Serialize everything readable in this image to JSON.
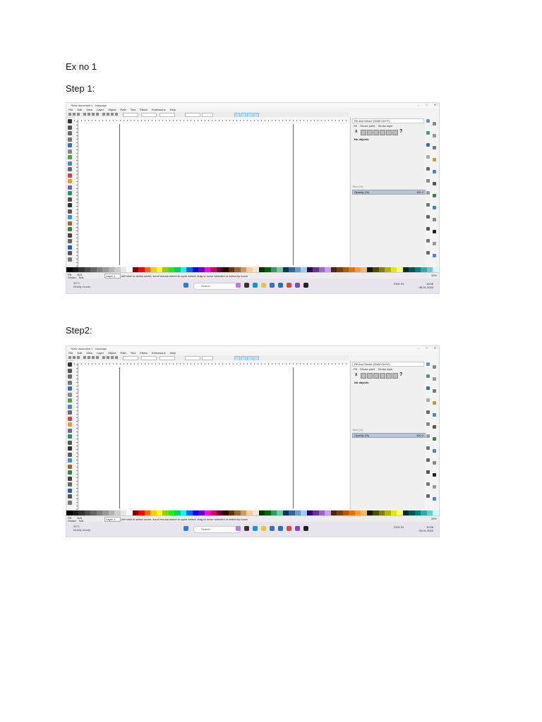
{
  "heading": "Ex no 1",
  "steps": [
    {
      "label": "Step 1:",
      "window_title": "*New document 1 - Inkscape",
      "menu": [
        "File",
        "Edit",
        "View",
        "Layer",
        "Object",
        "Path",
        "Text",
        "Filters",
        "Extensions",
        "Help"
      ],
      "panel_title": "Fill and Stroke (Shift+Ctrl+F)",
      "panel_tabs": [
        "Fill",
        "Stroke paint",
        "Stroke style"
      ],
      "no_objects": "No objects",
      "blur_label": "Blur (%)",
      "opacity_label": "Opacity (%)",
      "opacity_value": "100.0",
      "status_fill": "Fill:",
      "status_stroke": "Stroke:",
      "status_fill_value": "N/A",
      "status_stroke_value": "N/A",
      "layer": "Layer 1",
      "status_message": "Alt+click to select under; scroll mouse-wheel to cycle-select; drag to move selected or select by touch",
      "zoom": "33%",
      "search": "Search",
      "weather": "Mostly cloudy",
      "weather_temp": "30°C",
      "lang": "ENG IN",
      "time": "10:06",
      "date": "05-01-2024"
    },
    {
      "label": "Step2:",
      "window_title": "*New document 1 - Inkscape",
      "menu": [
        "File",
        "Edit",
        "View",
        "Layer",
        "Object",
        "Path",
        "Text",
        "Filters",
        "Extensions",
        "Help"
      ],
      "panel_title": "Fill and Stroke (Shift+Ctrl+F)",
      "panel_tabs": [
        "Fill",
        "Stroke paint",
        "Stroke style"
      ],
      "no_objects": "No objects",
      "blur_label": "Blur (%)",
      "opacity_label": "Opacity (%)",
      "opacity_value": "100.0",
      "status_fill": "Fill:",
      "status_stroke": "Stroke:",
      "status_fill_value": "N/A",
      "status_stroke_value": "N/A",
      "layer": "Layer 1",
      "status_message": "Alt+click to select under; scroll mouse-wheel to cycle-select; drag to move selected or select by touch",
      "zoom": "33%",
      "search": "Search",
      "weather": "Mostly cloudy",
      "weather_temp": "30°C",
      "lang": "ENG IN",
      "time": "10:06",
      "date": "05-01-2024"
    }
  ]
}
